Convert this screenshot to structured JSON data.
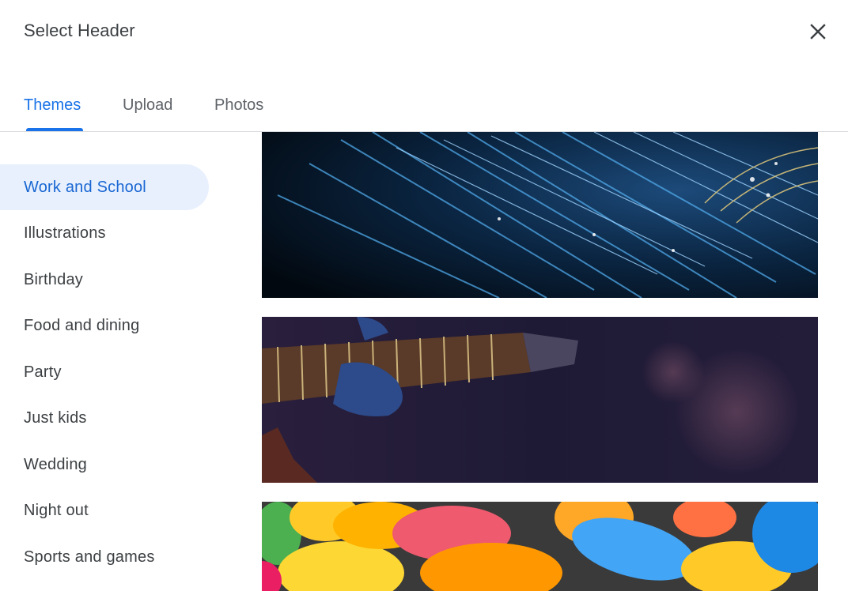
{
  "dialog": {
    "title": "Select Header",
    "close_icon": "close-icon"
  },
  "tabs": [
    {
      "label": "Themes",
      "active": true
    },
    {
      "label": "Upload",
      "active": false
    },
    {
      "label": "Photos",
      "active": false
    }
  ],
  "categories": [
    {
      "label": "Work and School",
      "active": true
    },
    {
      "label": "Illustrations",
      "active": false
    },
    {
      "label": "Birthday",
      "active": false
    },
    {
      "label": "Food and dining",
      "active": false
    },
    {
      "label": "Party",
      "active": false
    },
    {
      "label": "Just kids",
      "active": false
    },
    {
      "label": "Wedding",
      "active": false
    },
    {
      "label": "Night out",
      "active": false
    },
    {
      "label": "Sports and games",
      "active": false
    }
  ],
  "colors": {
    "accent": "#1a73e8",
    "active_bg": "#e8f0fe",
    "text": "#3c4043"
  }
}
